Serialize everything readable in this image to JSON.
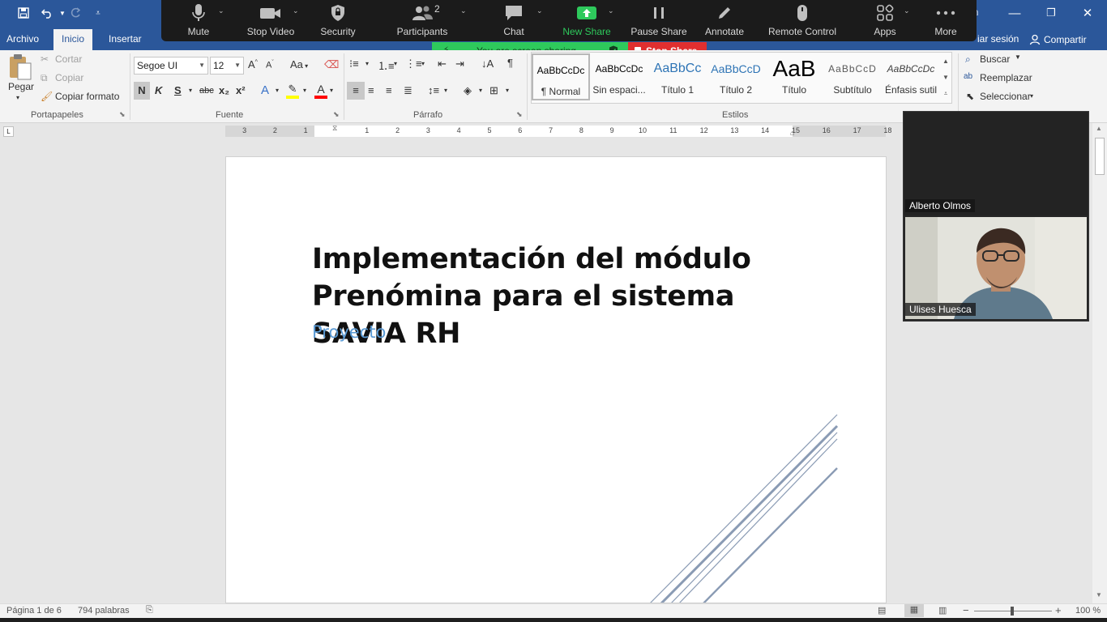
{
  "word": {
    "tabs": [
      "Archivo",
      "Inicio",
      "Insertar"
    ],
    "active_tab": "Inicio",
    "signin_partial": "iar sesión",
    "share_label": "Compartir",
    "clipboard": {
      "paste_label": "Pegar",
      "cut_label": "Cortar",
      "copy_label": "Copiar",
      "format_painter_label": "Copiar formato",
      "group_label": "Portapapeles"
    },
    "font": {
      "family": "Segoe UI",
      "size": "12",
      "bold": "N",
      "italic": "K",
      "underline": "S",
      "strike": "abc",
      "subscript": "x₂",
      "superscript": "x²",
      "case_label": "Aa",
      "group_label": "Fuente"
    },
    "paragraph": {
      "group_label": "Párrafo"
    },
    "styles": {
      "group_label": "Estilos",
      "items": [
        {
          "preview": "AaBbCcDc",
          "name": "¶ Normal"
        },
        {
          "preview": "AaBbCcDc",
          "name": "Sin espaci..."
        },
        {
          "preview": "AaBbCc",
          "name": "Título 1"
        },
        {
          "preview": "AaBbCcD",
          "name": "Título 2"
        },
        {
          "preview": "AaB",
          "name": "Título"
        },
        {
          "preview": "AaBbCcD",
          "name": "Subtítulo"
        },
        {
          "preview": "AaBbCcDc",
          "name": "Énfasis sutil"
        }
      ]
    },
    "editing": {
      "find_label": "Buscar",
      "replace_label": "Reemplazar",
      "select_label": "Seleccionar"
    },
    "ruler_numbers": [
      "3",
      "2",
      "1",
      "1",
      "2",
      "3",
      "4",
      "5",
      "6",
      "7",
      "8",
      "9",
      "10",
      "11",
      "12",
      "13",
      "14",
      "15",
      "16",
      "17",
      "18"
    ],
    "document": {
      "title": "Implementación del módulo Prenómina para el sistema SAVIA RH",
      "subtitle": "Proyecto"
    },
    "status": {
      "page": "Página 1 de 6",
      "words": "794 palabras",
      "zoom": "100 %"
    }
  },
  "zoom_toolbar": {
    "buttons": [
      {
        "label": "Mute",
        "icon": "microphone-icon"
      },
      {
        "label": "Stop Video",
        "icon": "video-camera-icon"
      },
      {
        "label": "Security",
        "icon": "shield-icon"
      },
      {
        "label": "Participants",
        "icon": "participants-icon",
        "badge": "2"
      },
      {
        "label": "Chat",
        "icon": "chat-bubble-icon"
      },
      {
        "label": "New Share",
        "icon": "share-arrow-icon"
      },
      {
        "label": "Pause Share",
        "icon": "pause-icon"
      },
      {
        "label": "Annotate",
        "icon": "pencil-icon"
      },
      {
        "label": "Remote Control",
        "icon": "mouse-icon"
      },
      {
        "label": "Apps",
        "icon": "apps-icon"
      },
      {
        "label": "More",
        "icon": "more-dots-icon"
      }
    ],
    "sharing_banner": "You are screen sharing",
    "stop_share_label": "Stop Share",
    "colors": {
      "toolbar_bg": "#1b1b1b",
      "share_green": "#2ec95c",
      "stop_red": "#e02f2f",
      "word_blue": "#2b579a"
    }
  },
  "participants": [
    {
      "name": "Alberto Olmos",
      "video": "off"
    },
    {
      "name": "Ulises Huesca",
      "video": "on"
    }
  ]
}
